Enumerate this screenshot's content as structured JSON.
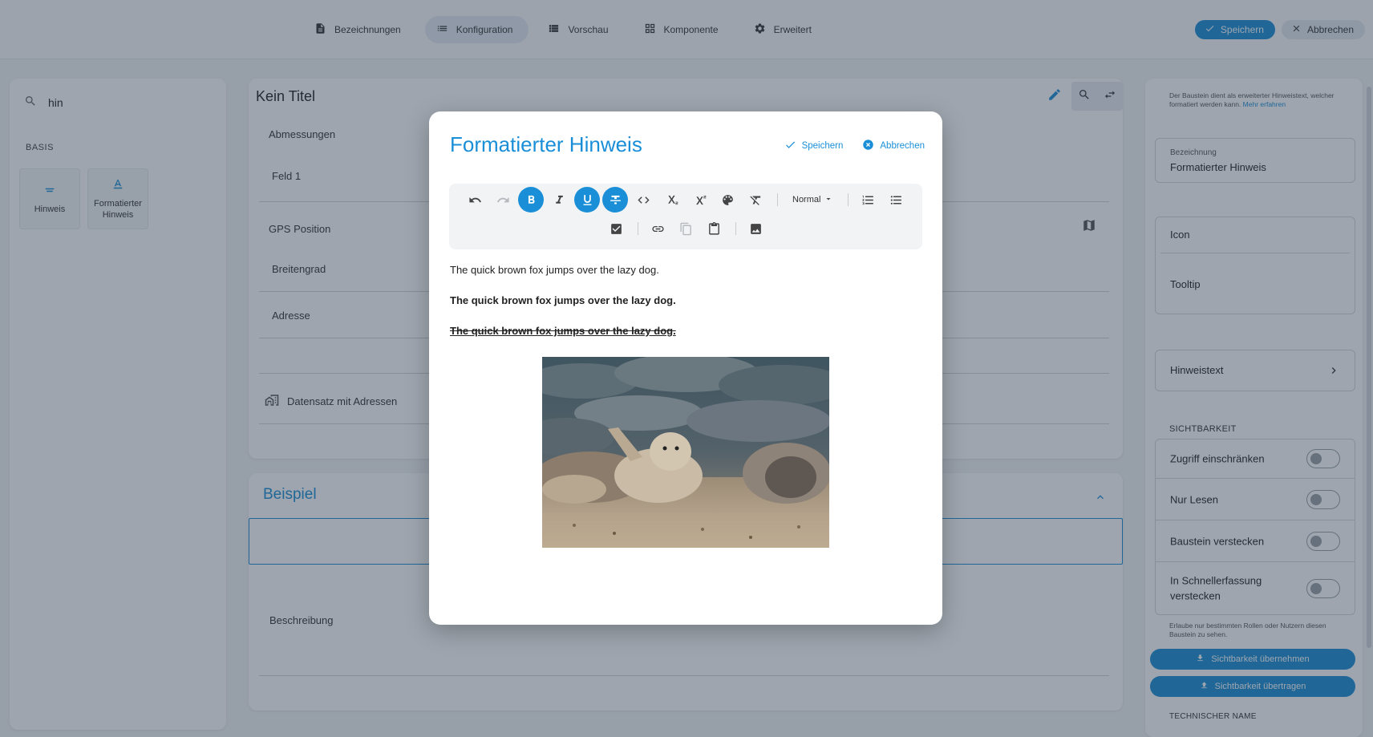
{
  "topbar": {
    "tabs": [
      {
        "label": "Bezeichnungen",
        "icon": "document-icon",
        "active": false
      },
      {
        "label": "Konfiguration",
        "icon": "list-icon",
        "active": true
      },
      {
        "label": "Vorschau",
        "icon": "table-icon",
        "active": false
      },
      {
        "label": "Komponente",
        "icon": "grid-icon",
        "active": false
      },
      {
        "label": "Erweitert",
        "icon": "gear-icon",
        "active": false
      }
    ],
    "save_label": "Speichern",
    "cancel_label": "Abbrechen"
  },
  "left_panel": {
    "search_value": "hin",
    "section_label": "BASIS",
    "components": [
      {
        "label": "Hinweis",
        "icon": "hint-icon"
      },
      {
        "label": "Formatierter Hinweis",
        "icon": "formatted-text-icon"
      }
    ]
  },
  "center_panel": {
    "title": "Kein Titel",
    "rows": [
      "Abmessungen",
      "Feld 1",
      "GPS Position",
      "Breitengrad",
      "Adresse",
      ""
    ],
    "dataset_label": "Datensatz mit Adressen"
  },
  "beispiel": {
    "title": "Beispiel",
    "description_label": "Beschreibung"
  },
  "right_panel": {
    "description": "Der Baustein dient als erweiterter Hinweistext, welcher formatiert werden kann.",
    "more_link": "Mehr erfahren",
    "name_label": "Bezeichnung",
    "name_value": "Formatierter Hinweis",
    "icon_label": "Icon",
    "tooltip_label": "Tooltip",
    "hint_text_label": "Hinweistext",
    "visibility_section": "SICHTBARKEIT",
    "toggles": [
      {
        "label": "Zugriff einschränken",
        "on": false
      },
      {
        "label": "Nur Lesen",
        "on": false
      },
      {
        "label": "Baustein verstecken",
        "on": false
      },
      {
        "label": "In Schnellerfassung verstecken",
        "on": false
      }
    ],
    "visibility_note": "Erlaube nur bestimmten Rollen oder Nutzern diesen Baustein zu sehen.",
    "apply_visibility": "Sichtbarkeit übernehmen",
    "transfer_visibility": "Sichtbarkeit übertragen",
    "technical_name_section": "TECHNISCHER NAME"
  },
  "modal": {
    "title": "Formatierter Hinweis",
    "save_label": "Speichern",
    "cancel_label": "Abbrechen",
    "heading_select": "Normal",
    "toolbar_active": [
      "bold",
      "underline",
      "strikethrough"
    ],
    "lines": [
      "The quick brown fox jumps over the lazy dog.",
      "The quick brown fox jumps over the lazy dog.",
      "The quick brown fox jumps over the lazy dog."
    ],
    "image_alt": "seals on a beach"
  },
  "colors": {
    "accent": "#1a8fd8",
    "overlay": "rgba(40,55,75,0.45)"
  }
}
